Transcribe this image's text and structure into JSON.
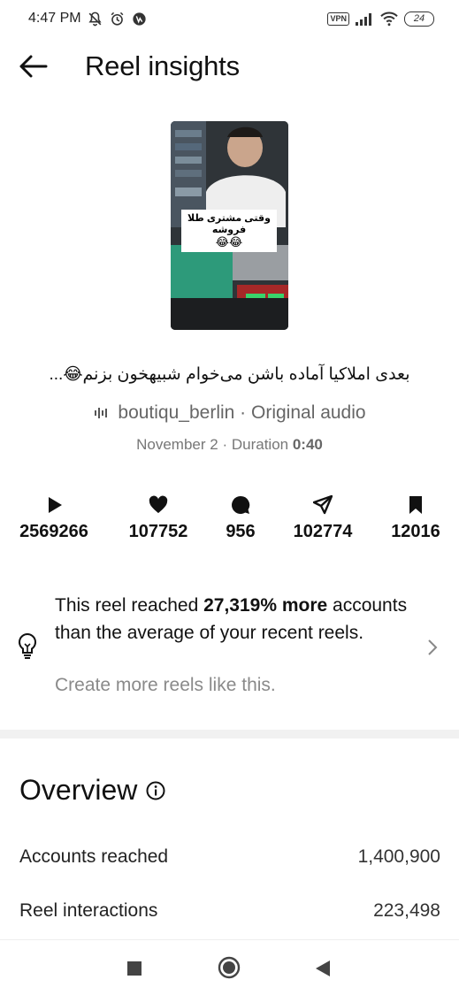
{
  "status_bar": {
    "time": "4:47 PM",
    "vpn": "VPN",
    "battery": "24"
  },
  "header": {
    "title": "Reel insights"
  },
  "reel": {
    "thumbnail_overlay_text": "وقتی مشتری طلا فروشه",
    "thumbnail_overlay_emoji": "😂😂",
    "caption": "بعدی املاکیا آماده باشن می‌خوام شبیهخون بزنم😂...",
    "username": "boutiqu_berlin",
    "audio_separator": " · ",
    "audio_label": "Original audio",
    "date": "November 2",
    "duration_label": " · Duration ",
    "duration_value": "0:40"
  },
  "stats": {
    "plays": "2569266",
    "likes": "107752",
    "comments": "956",
    "shares": "102774",
    "saves": "12016"
  },
  "insight": {
    "text_before": "This reel reached ",
    "highlight": "27,319% more",
    "text_after": " accounts than the average of your recent reels.",
    "subtext": "Create more reels like this."
  },
  "overview": {
    "title": "Overview",
    "metrics": [
      {
        "label": "Accounts reached",
        "value": "1,400,900"
      },
      {
        "label": "Reel interactions",
        "value": "223,498"
      }
    ]
  },
  "icons": {
    "play": "play-icon",
    "like": "heart-icon",
    "comment": "comment-icon",
    "share": "send-icon",
    "save": "bookmark-icon",
    "bulb": "lightbulb-icon"
  }
}
